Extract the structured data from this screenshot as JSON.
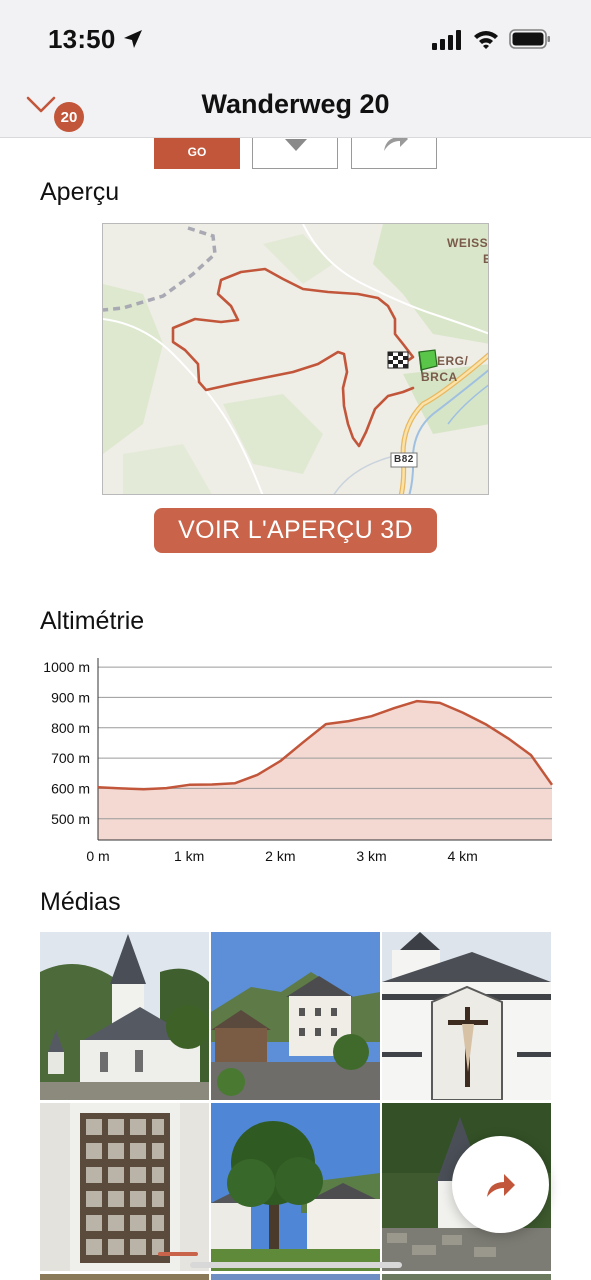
{
  "status_bar": {
    "time": "13:50"
  },
  "nav": {
    "title": "Wanderweg 20",
    "badge_count": "20"
  },
  "actions": {
    "go_label": "GO"
  },
  "overview": {
    "title": "Aperçu",
    "map_labels": {
      "weiss": "WEISS",
      "weiss_line2": "E",
      "town1": "ERG/",
      "town2": "BRCA",
      "road": "B82"
    },
    "button_3d": "VOIR L'APERÇU 3D"
  },
  "elevation": {
    "title": "Altimétrie",
    "chart_data": {
      "type": "area",
      "x_unit": "km",
      "y_unit": "m",
      "x": [
        0,
        0.25,
        0.5,
        0.75,
        1.0,
        1.25,
        1.5,
        1.75,
        2.0,
        2.25,
        2.5,
        2.75,
        3.0,
        3.25,
        3.5,
        3.75,
        4.0,
        4.25,
        4.5,
        4.75,
        4.98
      ],
      "y": [
        604,
        600,
        597,
        601,
        612,
        613,
        617,
        645,
        690,
        752,
        812,
        822,
        838,
        865,
        888,
        882,
        850,
        812,
        765,
        710,
        612
      ],
      "ylim": [
        430,
        1030
      ],
      "xlim": [
        0,
        4.98
      ],
      "y_ticks": [
        {
          "value": 500,
          "label": "500 m"
        },
        {
          "value": 600,
          "label": "600 m"
        },
        {
          "value": 700,
          "label": "700 m"
        },
        {
          "value": 800,
          "label": "800 m"
        },
        {
          "value": 900,
          "label": "900 m"
        },
        {
          "value": 1000,
          "label": "1000 m"
        }
      ],
      "x_ticks": [
        {
          "value": 0,
          "label": "0 m"
        },
        {
          "value": 1,
          "label": "1 km"
        },
        {
          "value": 2,
          "label": "2 km"
        },
        {
          "value": 3,
          "label": "3 km"
        },
        {
          "value": 4,
          "label": "4 km"
        }
      ],
      "grid": true,
      "colors": {
        "line": "#c2563a",
        "fill": "#f3d9d2",
        "grid": "#9a9a9a"
      }
    }
  },
  "media": {
    "title": "Médias"
  },
  "colors": {
    "accent": "#c2563a",
    "nav_bg": "#f2f2f4"
  }
}
